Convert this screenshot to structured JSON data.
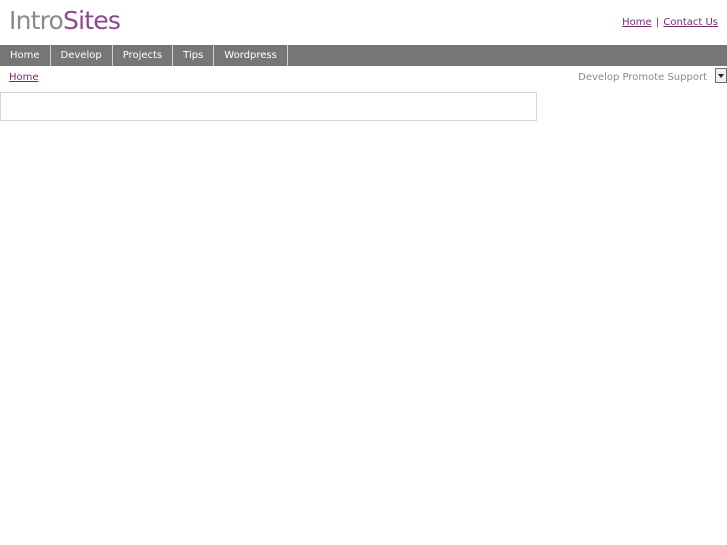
{
  "header": {
    "logo_intro": "Intro",
    "logo_sites": "Sites",
    "links": [
      {
        "label": "Home"
      },
      {
        "label": "Contact Us"
      }
    ],
    "link_separator": "|"
  },
  "nav": {
    "items": [
      {
        "label": "Home"
      },
      {
        "label": "Develop"
      },
      {
        "label": "Projects"
      },
      {
        "label": "Tips"
      },
      {
        "label": "Wordpress"
      }
    ]
  },
  "breadcrumb": {
    "home": "Home"
  },
  "tagline": "Develop Promote Support",
  "colors": {
    "brand_purple": "#93448f",
    "logo_gray": "#8a8a8a",
    "nav_bg": "#767676",
    "link": "#7a2a70"
  },
  "icons": {
    "dropdown": "chevron-down-icon"
  }
}
